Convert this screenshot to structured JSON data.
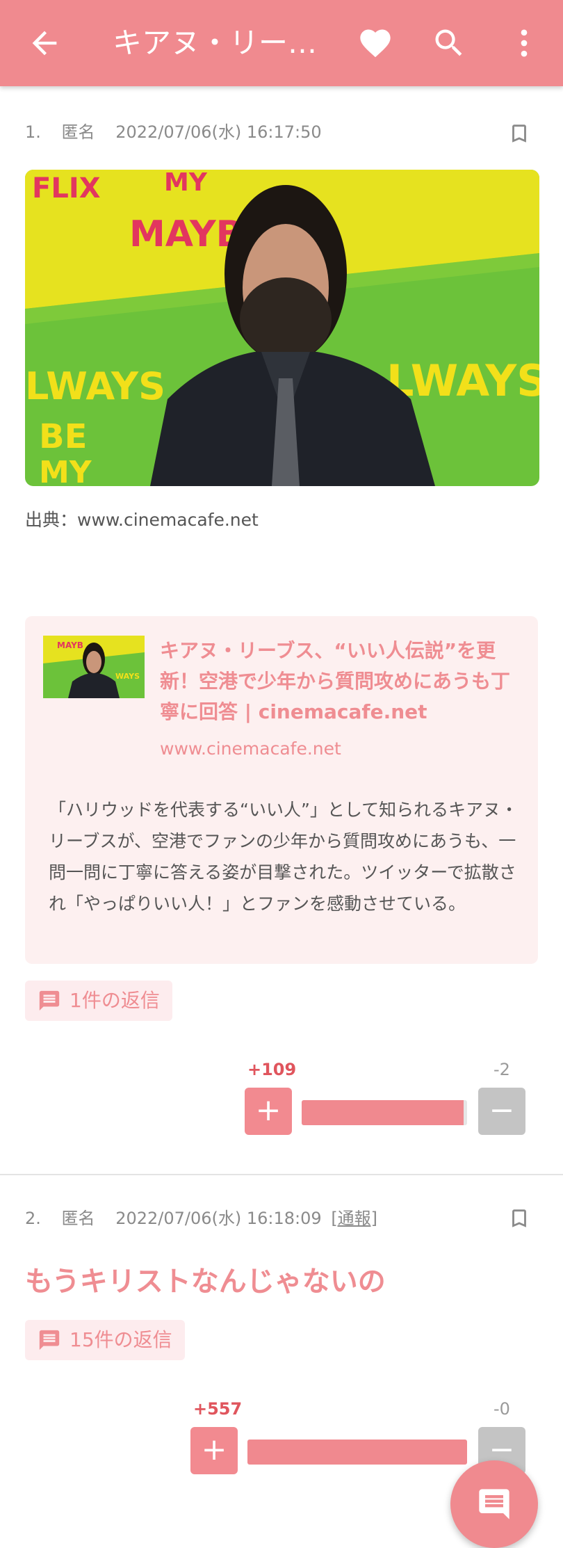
{
  "appbar": {
    "title": "キアヌ・リー…",
    "icons": [
      "back-arrow-icon",
      "heart-icon",
      "search-icon",
      "more-vert-icon"
    ],
    "color": "#f08a8f"
  },
  "posts": [
    {
      "number": "1.",
      "author": "匿名",
      "datetime": "2022/07/06(水) 16:17:50",
      "source": "出典：www.cinemacafe.net",
      "link_card": {
        "title": "キアヌ・リーブス、“いい人伝説”を更新！空港で少年から質問攻めにあうも丁寧に回答 | cinemacafe.net",
        "url": "www.cinemacafe.net",
        "description": "「ハリウッドを代表する“いい人”」として知られるキアヌ・リーブスが、空港でファンの少年から質問攻めにあうも、一問一問に丁寧に答える姿が目撃された。ツイッターで拡散され「やっぱりいい人！」とファンを感動させている。"
      },
      "replies": "1件の返信",
      "plus": "+109",
      "minus": "-2",
      "plus_ratio": 0.98
    },
    {
      "number": "2.",
      "author": "匿名",
      "datetime": "2022/07/06(水) 16:18:09",
      "report": "[通報]",
      "body": "もうキリストなんじゃないの",
      "replies": "15件の返信",
      "plus": "+557",
      "minus": "-0",
      "plus_ratio": 1.0
    }
  ]
}
